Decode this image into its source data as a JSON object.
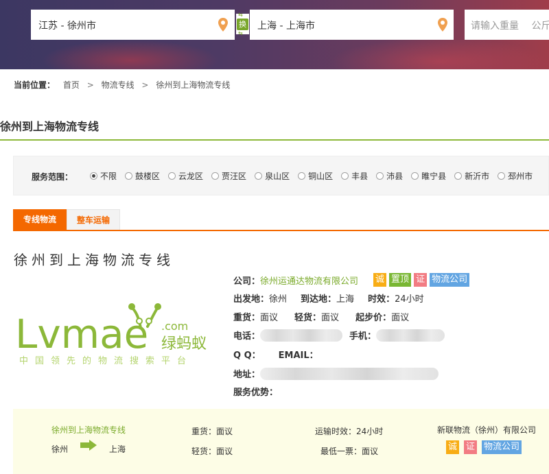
{
  "search": {
    "from_value": "江苏 - 徐州市",
    "swap_label": "换",
    "to_value": "上海 - 上海市",
    "weight_placeholder": "请输入重量",
    "weight_unit": "公斤"
  },
  "breadcrumb": {
    "prefix": "当前位置：",
    "items": [
      "首页",
      "物流专线",
      "徐州到上海物流专线"
    ],
    "separator": ">"
  },
  "page_title": "徐州到上海物流专线",
  "filter": {
    "label": "服务范围：",
    "options": [
      "不限",
      "鼓楼区",
      "云龙区",
      "贾汪区",
      "泉山区",
      "铜山区",
      "丰县",
      "沛县",
      "睢宁县",
      "新沂市",
      "邳州市"
    ],
    "selected": "不限"
  },
  "tabs": [
    "专线物流",
    "整车运输"
  ],
  "active_tab": "专线物流",
  "section_heading": "徐州到上海物流专线",
  "logo": {
    "wordmark": "Lvmae",
    "domain": ".com",
    "cn_name": "绿蚂蚁",
    "slogan": "中国领先的物流搜索平台"
  },
  "details": {
    "company_label": "公司：",
    "company_name": "徐州运通达物流有限公司",
    "badges": [
      "诚",
      "置顶",
      "证",
      "物流公司"
    ],
    "origin_label": "出发地：",
    "origin": "徐州",
    "destination_label": "到达地：",
    "destination": "上海",
    "duration_label": "时效：",
    "duration": "24小时",
    "heavy_label": "重货：",
    "heavy": "面议",
    "light_label": "轻货：",
    "light": "面议",
    "min_label": "起步价：",
    "min_price": "面议",
    "phone_label": "电话：",
    "mobile_label": "手机：",
    "qq_label": "Q Q：",
    "email_label": "EMAIL：",
    "address_label": "地址：",
    "advantage_label": "服务优势："
  },
  "summary": {
    "route_title": "徐州到上海物流专线",
    "from": "徐州",
    "to": "上海",
    "heavy": "重货：面议",
    "light": "轻货：面议",
    "duration": "运输时效：24小时",
    "min_ticket": "最低一票：面议",
    "company": "新联物流（徐州）有限公司",
    "badges": [
      "诚",
      "证",
      "物流公司"
    ]
  },
  "colors": {
    "brand_green": "#8cb839",
    "accent_orange": "#f46800",
    "badge_orange": "#f8ad15",
    "badge_green": "#79b733",
    "badge_pink": "#f27c83",
    "badge_blue": "#62a5e2",
    "summary_bg": "#fdfde6"
  }
}
